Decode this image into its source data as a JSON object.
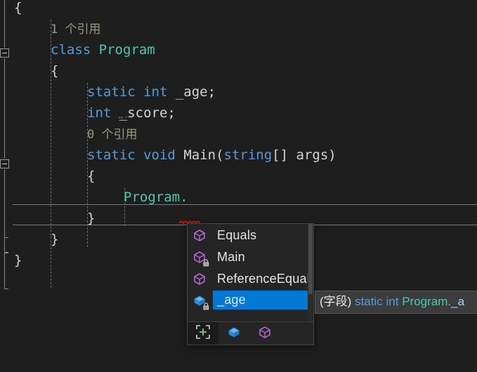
{
  "editor": {
    "background": "#1e1e1e",
    "lines": [
      {
        "indent": 0,
        "segments": [
          {
            "t": "{",
            "c": "brace"
          }
        ]
      },
      {
        "indent": 1,
        "segments": [
          {
            "t": "1 个引用",
            "c": "codelens"
          }
        ]
      },
      {
        "indent": 1,
        "segments": [
          {
            "t": "class",
            "c": "kw"
          },
          {
            "t": " ",
            "c": "plain"
          },
          {
            "t": "Program",
            "c": "type"
          }
        ]
      },
      {
        "indent": 1,
        "segments": [
          {
            "t": "{",
            "c": "brace"
          }
        ]
      },
      {
        "indent": 2,
        "segments": [
          {
            "t": "static",
            "c": "kw"
          },
          {
            "t": " ",
            "c": "plain"
          },
          {
            "t": "int",
            "c": "kw"
          },
          {
            "t": " _age;",
            "c": "plain"
          }
        ]
      },
      {
        "indent": 2,
        "segments": [
          {
            "t": "int",
            "c": "kw"
          },
          {
            "t": " _score;",
            "c": "plain"
          }
        ]
      },
      {
        "indent": 2,
        "segments": [
          {
            "t": "0 个引用",
            "c": "codelens"
          }
        ]
      },
      {
        "indent": 2,
        "segments": [
          {
            "t": "static",
            "c": "kw"
          },
          {
            "t": " ",
            "c": "plain"
          },
          {
            "t": "void",
            "c": "kw"
          },
          {
            "t": " ",
            "c": "plain"
          },
          {
            "t": "Main",
            "c": "plain"
          },
          {
            "t": "(",
            "c": "punct"
          },
          {
            "t": "string",
            "c": "kw"
          },
          {
            "t": "[] ",
            "c": "punct"
          },
          {
            "t": "args",
            "c": "plain"
          },
          {
            "t": ")",
            "c": "punct"
          }
        ]
      },
      {
        "indent": 2,
        "segments": [
          {
            "t": "{",
            "c": "brace"
          }
        ]
      },
      {
        "indent": 3,
        "segments": [
          {
            "t": "Program",
            "c": "type"
          },
          {
            "t": ".",
            "c": "type"
          }
        ]
      },
      {
        "indent": 2,
        "segments": [
          {
            "t": "}",
            "c": "brace"
          }
        ]
      },
      {
        "indent": 1,
        "segments": [
          {
            "t": "}",
            "c": "brace"
          }
        ]
      },
      {
        "indent": 0,
        "segments": [
          {
            "t": "}",
            "c": "brace"
          }
        ]
      }
    ],
    "current_line_index": 9,
    "error_underline_color": "#e51400",
    "colors": {
      "keyword": "#569cd6",
      "type": "#4ec9b0",
      "plain_text": "#d4d4d4",
      "codelens": "#9a9a80",
      "indent_guide": "#6d6d6d"
    }
  },
  "autocomplete": {
    "items": [
      {
        "label": "Equals",
        "icon": "method-cube-icon",
        "private": false,
        "selected": false
      },
      {
        "label": "Main",
        "icon": "method-cube-icon",
        "private": true,
        "selected": false
      },
      {
        "label": "ReferenceEquals",
        "icon": "method-cube-icon",
        "private": false,
        "selected": false
      },
      {
        "label": "_age",
        "icon": "field-cube-icon",
        "private": true,
        "selected": true
      }
    ],
    "selection_color": "#0078d4",
    "toolbar": [
      {
        "name": "expand-all-button",
        "icon": "expand-plus-icon",
        "active": true
      },
      {
        "name": "filter-fields-button",
        "icon": "field-cube-icon",
        "active": false
      },
      {
        "name": "filter-methods-button",
        "icon": "method-cube-icon",
        "active": false
      }
    ]
  },
  "tooltip": {
    "kind": "(字段)",
    "modifier": "static",
    "type": "int",
    "owner": "Program",
    "dot": ".",
    "member": "_a"
  }
}
